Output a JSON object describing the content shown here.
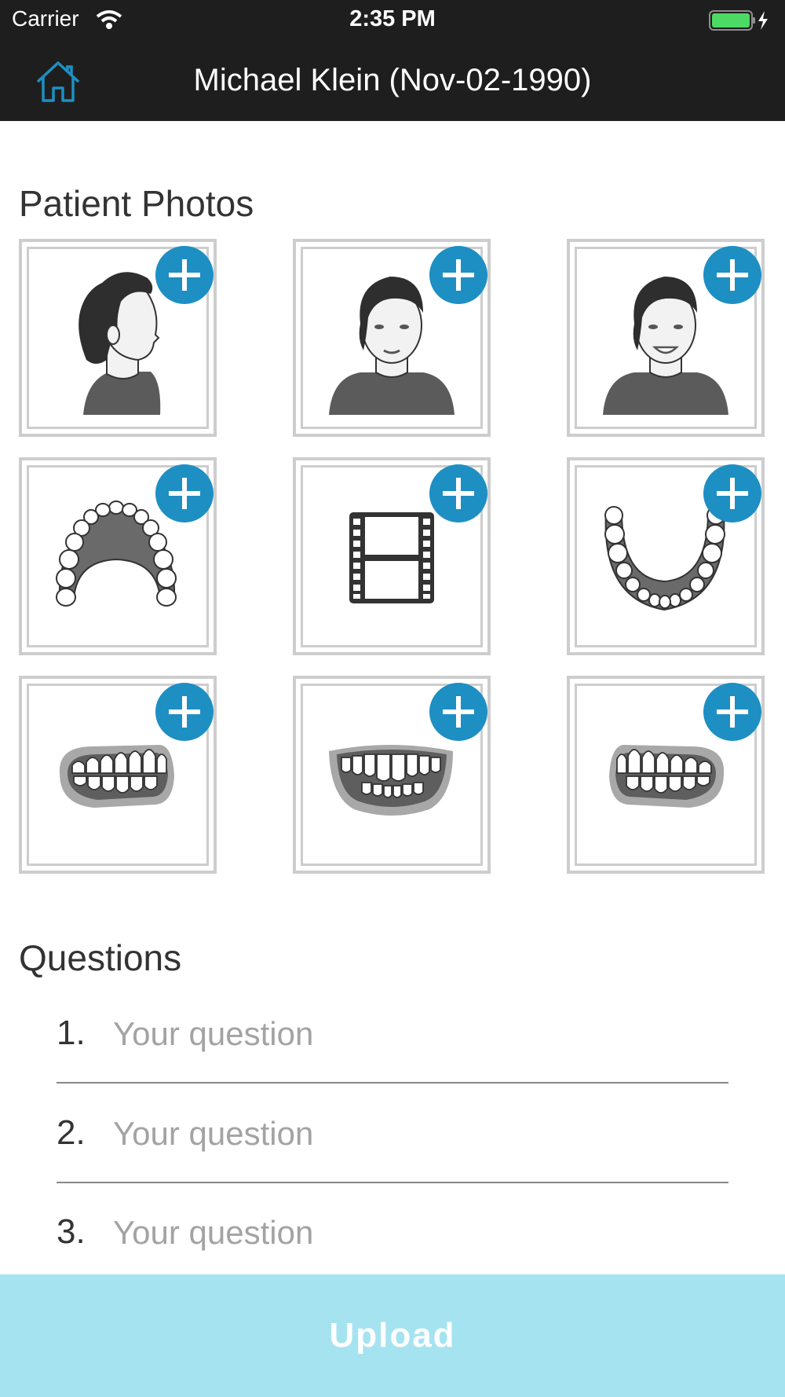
{
  "status": {
    "carrier": "Carrier",
    "time": "2:35 PM",
    "battery_color": "#4cd964"
  },
  "nav": {
    "home_icon": "home-icon",
    "title": "Michael Klein (Nov-02-1990)",
    "accent_color": "#1d8fc3"
  },
  "photos": {
    "title": "Patient Photos",
    "add_icon": "plus-icon",
    "tiles": [
      {
        "icon": "face-profile-icon"
      },
      {
        "icon": "face-front-icon"
      },
      {
        "icon": "face-smile-icon"
      },
      {
        "icon": "upper-arch-icon"
      },
      {
        "icon": "video-film-icon"
      },
      {
        "icon": "lower-arch-icon"
      },
      {
        "icon": "teeth-right-icon"
      },
      {
        "icon": "teeth-front-icon"
      },
      {
        "icon": "teeth-left-icon"
      }
    ]
  },
  "questions": {
    "title": "Questions",
    "items": [
      {
        "number": "1.",
        "placeholder": "Your question",
        "value": ""
      },
      {
        "number": "2.",
        "placeholder": "Your question",
        "value": ""
      },
      {
        "number": "3.",
        "placeholder": "Your question",
        "value": ""
      }
    ]
  },
  "upload": {
    "label": "Upload",
    "color": "#a6e3f0"
  }
}
